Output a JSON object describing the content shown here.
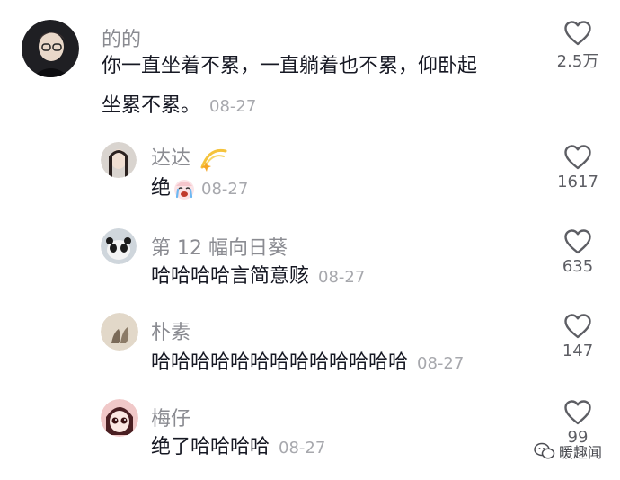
{
  "comments": [
    {
      "username": "的的",
      "text_line1": "你一直坐着不累，一直躺着也不累，仰卧起",
      "text_line2": "坐累不累。",
      "date": "08-27",
      "likes": "2.5万"
    },
    {
      "username": "达达",
      "text": "绝",
      "date": "08-27",
      "likes": "1617"
    },
    {
      "username": "第 12 幅向日葵",
      "text": "哈哈哈哈言简意赅",
      "date": "08-27",
      "likes": "635"
    },
    {
      "username": "朴素",
      "text": "哈哈哈哈哈哈哈哈哈哈哈哈哈",
      "date": "08-27",
      "likes": "147"
    },
    {
      "username": "梅仔",
      "text": "绝了哈哈哈哈",
      "date": "08-27",
      "likes": "99"
    }
  ],
  "watermark": "暖趣闻",
  "colors": {
    "text": "#161823",
    "username": "#8a8b91",
    "date": "#a7a8ad",
    "like_icon": "#5d5e64"
  }
}
